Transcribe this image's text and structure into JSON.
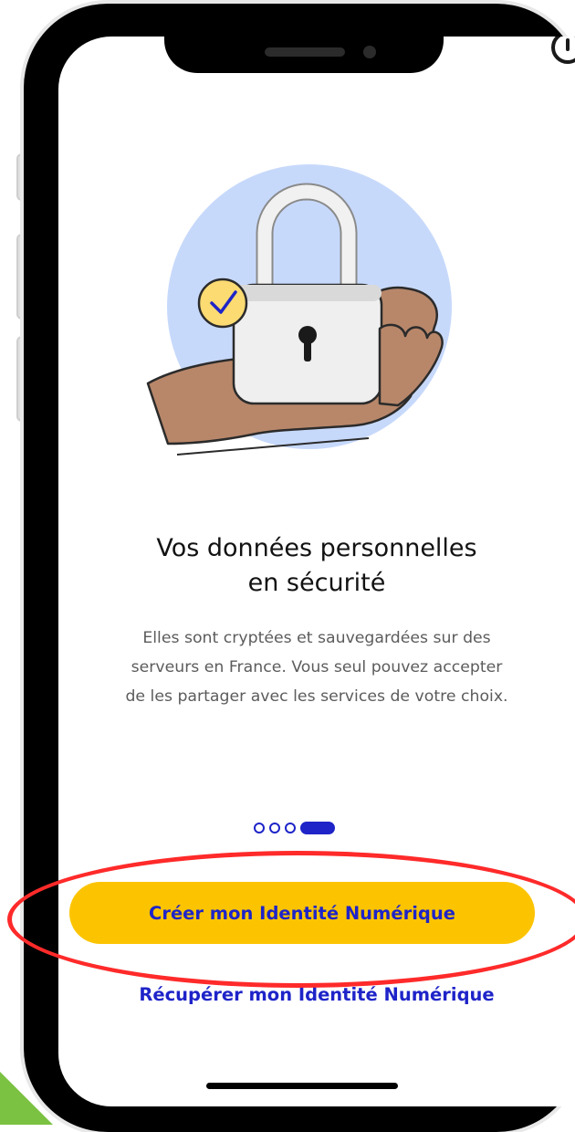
{
  "screen": {
    "title_line1": "Vos données personnelles",
    "title_line2": "en sécurité",
    "description_line1": "Elles sont cryptées et sauvegardées sur des",
    "description_line2": "serveurs en France. Vous seul pouvez accepter",
    "description_line3": "de les partager avec les services de votre choix.",
    "pager": {
      "total": 4,
      "current": 4
    },
    "primary_button_label": "Créer mon Identité Numérique",
    "secondary_link_label": "Récupérer mon Identité Numérique"
  },
  "colors": {
    "accent_blue": "#1e24c8",
    "button_yellow": "#fcc400",
    "illustration_circle": "#c7d9fb",
    "highlight_red": "#ff2a2a"
  },
  "icons": {
    "illustration": "padlock-in-hand",
    "badge": "checkmark-badge-icon",
    "corner": "info-icon"
  }
}
